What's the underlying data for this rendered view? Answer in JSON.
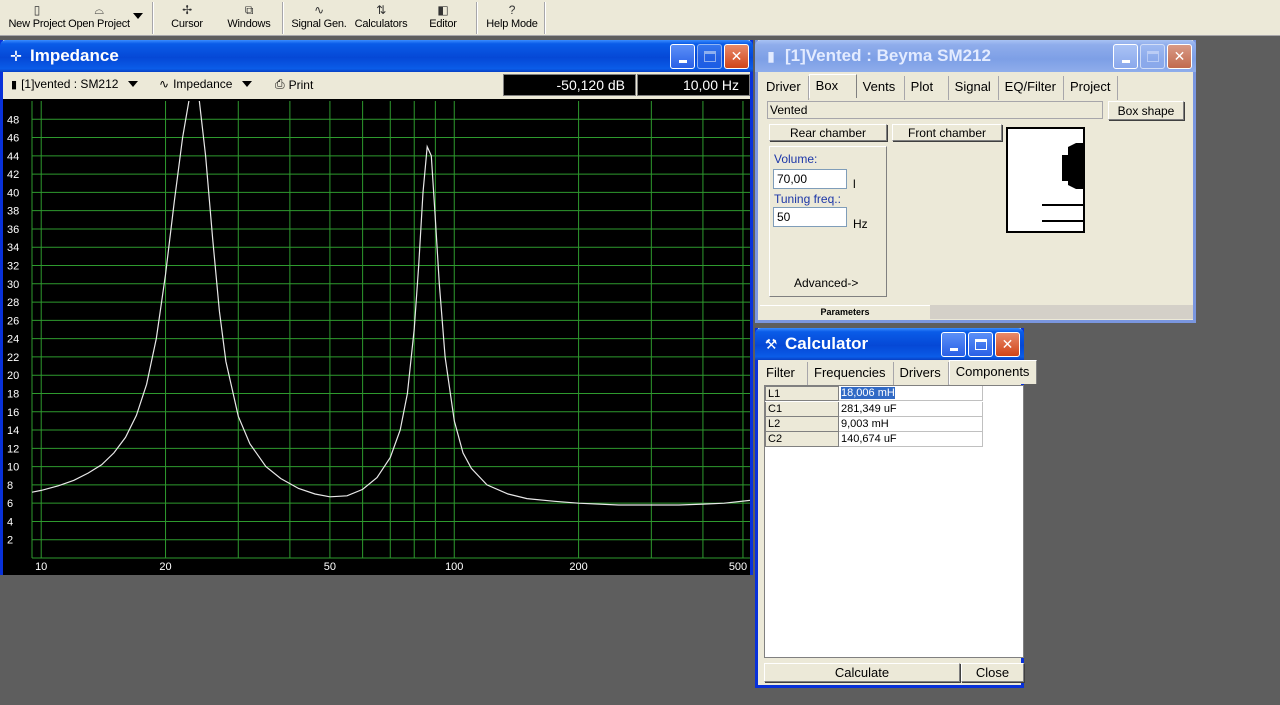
{
  "toolbar": {
    "new_project": "New Project",
    "open_project": "Open Project",
    "cursor": "Cursor",
    "windows": "Windows",
    "signal_gen": "Signal Gen.",
    "calculators": "Calculators",
    "editor": "Editor",
    "help_mode": "Help Mode",
    "help_icon": "?"
  },
  "impedance_window": {
    "title": "Impedance",
    "project_select": "[1]vented : SM212",
    "view_select": "Impedance",
    "print_label": "Print",
    "readout_db": "-50,120 dB",
    "readout_hz": "10,00 Hz"
  },
  "chart_data": {
    "type": "line",
    "title": "",
    "xlabel": "",
    "ylabel": "",
    "x_scale": "log",
    "xlim": [
      9.5,
      520
    ],
    "ylim": [
      0,
      50
    ],
    "x_ticks": [
      10,
      20,
      50,
      100,
      200,
      500
    ],
    "x_tick_labels": [
      "10",
      "20",
      "50",
      "100",
      "200",
      "500"
    ],
    "y_ticks": [
      2,
      4,
      6,
      8,
      10,
      12,
      14,
      16,
      18,
      20,
      22,
      24,
      26,
      28,
      30,
      32,
      34,
      36,
      38,
      40,
      42,
      44,
      46,
      48
    ],
    "y_tick_labels": [
      "2",
      "4",
      "6",
      "8",
      "10",
      "12",
      "14",
      "16",
      "18",
      "20",
      "22",
      "24",
      "26",
      "28",
      "30",
      "32",
      "34",
      "36",
      "38",
      "40",
      "42",
      "44",
      "46",
      "48"
    ],
    "grid": true,
    "background": "#000000",
    "grid_color": "#2e9a2e",
    "line_color": "#e8e8e8",
    "series": [
      {
        "x": [
          9.5,
          10,
          11,
          12,
          13,
          14,
          15,
          16,
          17,
          18,
          19,
          20,
          21,
          22,
          23,
          24,
          25,
          26,
          27,
          28,
          30,
          32,
          35,
          38,
          42,
          46,
          50,
          55,
          60,
          65,
          70,
          74,
          77,
          80,
          82,
          84,
          86,
          88,
          90,
          92,
          95,
          100,
          105,
          110,
          120,
          135,
          150,
          175,
          200,
          250,
          300,
          350,
          400,
          450,
          520
        ],
        "y": [
          7.2,
          7.4,
          7.9,
          8.5,
          9.3,
          10.2,
          11.5,
          13.2,
          15.6,
          19,
          24,
          31,
          39,
          46,
          52,
          52,
          44,
          35,
          27,
          21.5,
          15.5,
          12.5,
          10,
          8.7,
          7.6,
          7,
          6.7,
          6.8,
          7.5,
          8.8,
          11,
          14,
          18,
          25,
          32,
          40,
          45,
          44,
          37,
          30,
          22,
          15,
          11.5,
          9.8,
          8,
          7,
          6.5,
          6.2,
          6.0,
          5.8,
          5.8,
          5.8,
          5.9,
          6.0,
          6.3
        ]
      }
    ]
  },
  "vented_window": {
    "title": "[1]Vented : Beyma SM212",
    "tabs": [
      "Driver",
      "Box",
      "Vents",
      "Plot",
      "Signal",
      "EQ/Filter",
      "Project"
    ],
    "selected_tab": "Box",
    "box_type": "Vented",
    "box_shape_button": "Box shape",
    "rear_chamber_button": "Rear chamber",
    "front_chamber_button": "Front chamber",
    "volume_label": "Volume:",
    "volume_value": "70,00",
    "volume_unit": "l",
    "tuning_label": "Tuning freq.:",
    "tuning_value": "50",
    "tuning_unit": "Hz",
    "advanced_link": "Advanced->",
    "status_tab": "Parameters"
  },
  "calculator_window": {
    "title": "Calculator",
    "tabs": [
      "Filter",
      "Frequencies",
      "Drivers",
      "Components"
    ],
    "selected_tab": "Components",
    "rows": [
      {
        "name": "L1",
        "value": "18,006 mH"
      },
      {
        "name": "C1",
        "value": "281,349 uF"
      },
      {
        "name": "L2",
        "value": "9,003 mH"
      },
      {
        "name": "C2",
        "value": "140,674 uF"
      }
    ],
    "calculate_button": "Calculate",
    "close_button": "Close"
  }
}
